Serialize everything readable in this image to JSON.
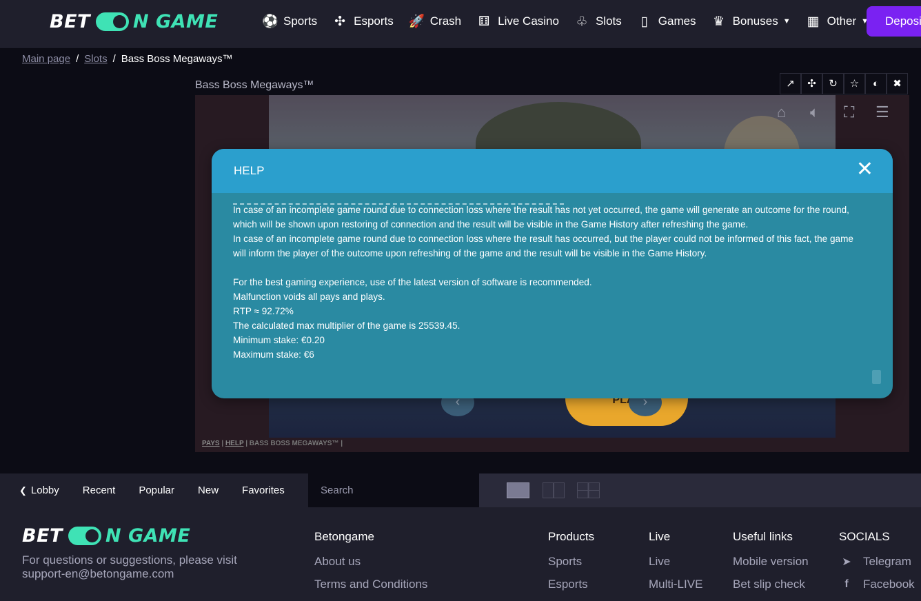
{
  "brand": {
    "word1": "BET",
    "word2": "N GAME"
  },
  "nav": {
    "items": [
      {
        "label": "Sports",
        "icon": "⚽"
      },
      {
        "label": "Esports",
        "icon": "✣"
      },
      {
        "label": "Crash",
        "icon": "🚀"
      },
      {
        "label": "Live Casino",
        "icon": "⚅"
      },
      {
        "label": "Slots",
        "icon": "♧"
      },
      {
        "label": "Games",
        "icon": "▯"
      },
      {
        "label": "Bonuses",
        "icon": "♛"
      },
      {
        "label": "Other",
        "icon": "▦"
      }
    ],
    "deposit": "Deposit"
  },
  "breadcrumb": {
    "home": "Main page",
    "slots": "Slots",
    "current": "Bass Boss Megaways™"
  },
  "game": {
    "title": "Bass Boss Megaways™",
    "play": "PLAY",
    "footer": {
      "pays": "PAYS",
      "help": "HELP",
      "name": "BASS BOSS MEGAWAYS™"
    }
  },
  "help": {
    "title": "HELP",
    "p1": "In case of an incomplete game round due to connection loss where the result has not yet occurred, the game will generate an outcome for the round, which will be shown upon restoring of connection and the result will be visible in the Game History after refreshing the game.",
    "p2": "In case of an incomplete game round due to connection loss where the result has occurred, but the player could not be informed of this fact, the game will inform the player of the outcome upon refreshing of the game and the result will be visible in the Game History.",
    "p3": "For the best gaming experience, use of the latest version of software is recommended.",
    "p4": "Malfunction voids all pays and plays.",
    "rtp": "RTP ≈ 92.72%",
    "maxmult": "The calculated max multiplier of the game is 25539.45.",
    "minstake": "Minimum stake: €0.20",
    "maxstake": "Maximum stake: €6"
  },
  "lobby": {
    "back": "Lobby",
    "recent": "Recent",
    "popular": "Popular",
    "new": "New",
    "favorites": "Favorites",
    "search_placeholder": "Search"
  },
  "footer": {
    "contact": "For questions or suggestions, please visit support-en@betongame.com",
    "col1": {
      "title": "Betongame",
      "links": [
        "About us",
        "Terms and Conditions"
      ]
    },
    "col2": {
      "title": "Products",
      "links": [
        "Sports",
        "Esports"
      ]
    },
    "col3": {
      "title": "Live",
      "links": [
        "Live",
        "Multi-LIVE"
      ]
    },
    "col4": {
      "title": "Useful links",
      "links": [
        "Mobile version",
        "Bet slip check"
      ]
    },
    "col5": {
      "title": "SOCIALS",
      "links": [
        "Telegram",
        "Facebook"
      ]
    }
  },
  "colors": {
    "accent": "#3fe2b5",
    "deposit": "#7a22f2",
    "help_header": "#2b9fcd",
    "help_body": "#2a8aa2"
  }
}
